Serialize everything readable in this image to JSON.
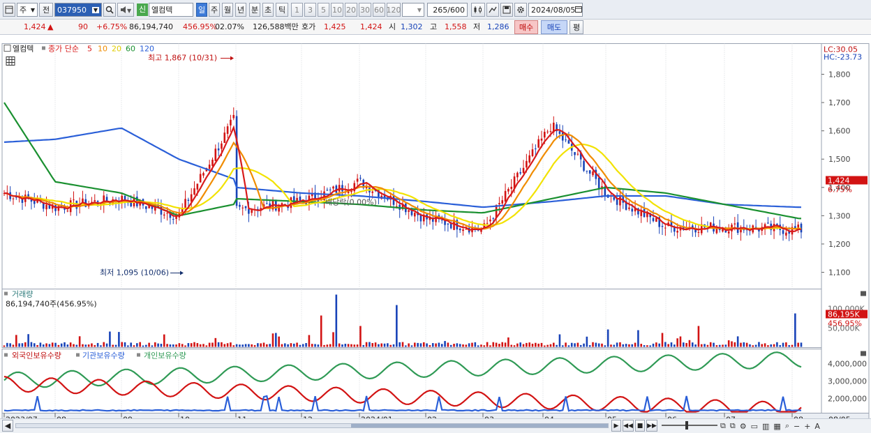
{
  "toolbar": {
    "market_type": "주",
    "all_label": "전",
    "stock_code": "037950",
    "stock_name": "엘컴텍",
    "new_badge": "신",
    "periods": [
      "일",
      "주",
      "월",
      "년",
      "분",
      "초",
      "틱"
    ],
    "selected_period": "일",
    "intervals": [
      "1",
      "3",
      "5",
      "10",
      "20",
      "30",
      "60",
      "120"
    ],
    "count_value": "265",
    "count_total": "/600",
    "date_value": "2024/08/05"
  },
  "quote": {
    "price": "1,424",
    "change_arrow": "▲",
    "change": "90",
    "change_rate": "+6.75%",
    "volume": "86,194,740",
    "volume_ratio": "456.95%",
    "turnover": "02.07%",
    "amount": "126,588백만",
    "bid_label": "호가",
    "bid": "1,425",
    "ask": "1,424",
    "open_label": "시",
    "open": "1,302",
    "high_label": "고",
    "high": "1,558",
    "low_label": "저",
    "low": "1,286",
    "buy_label": "매수",
    "sell_label": "매도",
    "eval_label": "평"
  },
  "chart": {
    "stock_label": "엘컴텍",
    "ma_label": "종가 단순",
    "ma_periods": [
      "5",
      "10",
      "20",
      "60",
      "120"
    ],
    "ma_colors": [
      "#d81b1b",
      "#f08c00",
      "#f2e200",
      "#1a9030",
      "#2a5fd8"
    ],
    "high_annotation": "최고 1,867 (10/31)",
    "low_annotation": "최저 1,095 (10/06)",
    "ex_dividend_annotation": "배당락(0.00%)",
    "lc_label": "LC:30.05",
    "hc_label": "HC:-23.73",
    "y_ticks": [
      "1,800",
      "1,700",
      "1,600",
      "1,500",
      "1,400",
      "1,300",
      "1,200",
      "1,100"
    ],
    "current_price_tag": "1,424",
    "current_rate_tag": "6.75%",
    "volume_title": "거래량",
    "volume_value": "86,194,740주(456.95%)",
    "volume_ticks": [
      "100,000K",
      "50,000K"
    ],
    "volume_tag": "86,195K",
    "volume_rate_tag": "456.95%",
    "holdings_legend": [
      "외국인보유수량",
      "기관보유수량",
      "개인보유수량"
    ],
    "holdings_ticks": [
      "4,000,000",
      "3,000,000",
      "2,000,000"
    ],
    "x_labels": [
      "2023/07",
      "08",
      "09",
      "10",
      "11",
      "12",
      "2024/01",
      "02",
      "03",
      "04",
      "05",
      "06",
      "07",
      "08"
    ],
    "x_right_label": "08/05"
  },
  "colors": {
    "up": "#d21313",
    "down": "#1843b8",
    "foreign": "#d21313",
    "institution": "#2a5fd8",
    "individual": "#2f9a55"
  },
  "chart_data": {
    "type": "line",
    "title": "",
    "xlabel": "",
    "ylabel": "",
    "ylim": [
      1070,
      1900
    ],
    "x": [
      "2023/07",
      "08",
      "09",
      "10",
      "10/31",
      "11",
      "12",
      "2024/01",
      "02",
      "03",
      "04",
      "05",
      "06",
      "07",
      "08/05"
    ],
    "series": [
      {
        "name": "5",
        "values": [
          1380,
          1330,
          1360,
          1300,
          1640,
          1320,
          1350,
          1420,
          1290,
          1250,
          1620,
          1380,
          1260,
          1260,
          1250
        ]
      },
      {
        "name": "120",
        "values": [
          1560,
          1570,
          1610,
          1500,
          1430,
          1400,
          1380,
          1370,
          1350,
          1330,
          1350,
          1370,
          1370,
          1340,
          1330
        ]
      },
      {
        "name": "60",
        "values": [
          1700,
          1420,
          1380,
          1300,
          1340,
          1360,
          1350,
          1340,
          1320,
          1310,
          1360,
          1400,
          1380,
          1340,
          1290
        ]
      }
    ]
  }
}
